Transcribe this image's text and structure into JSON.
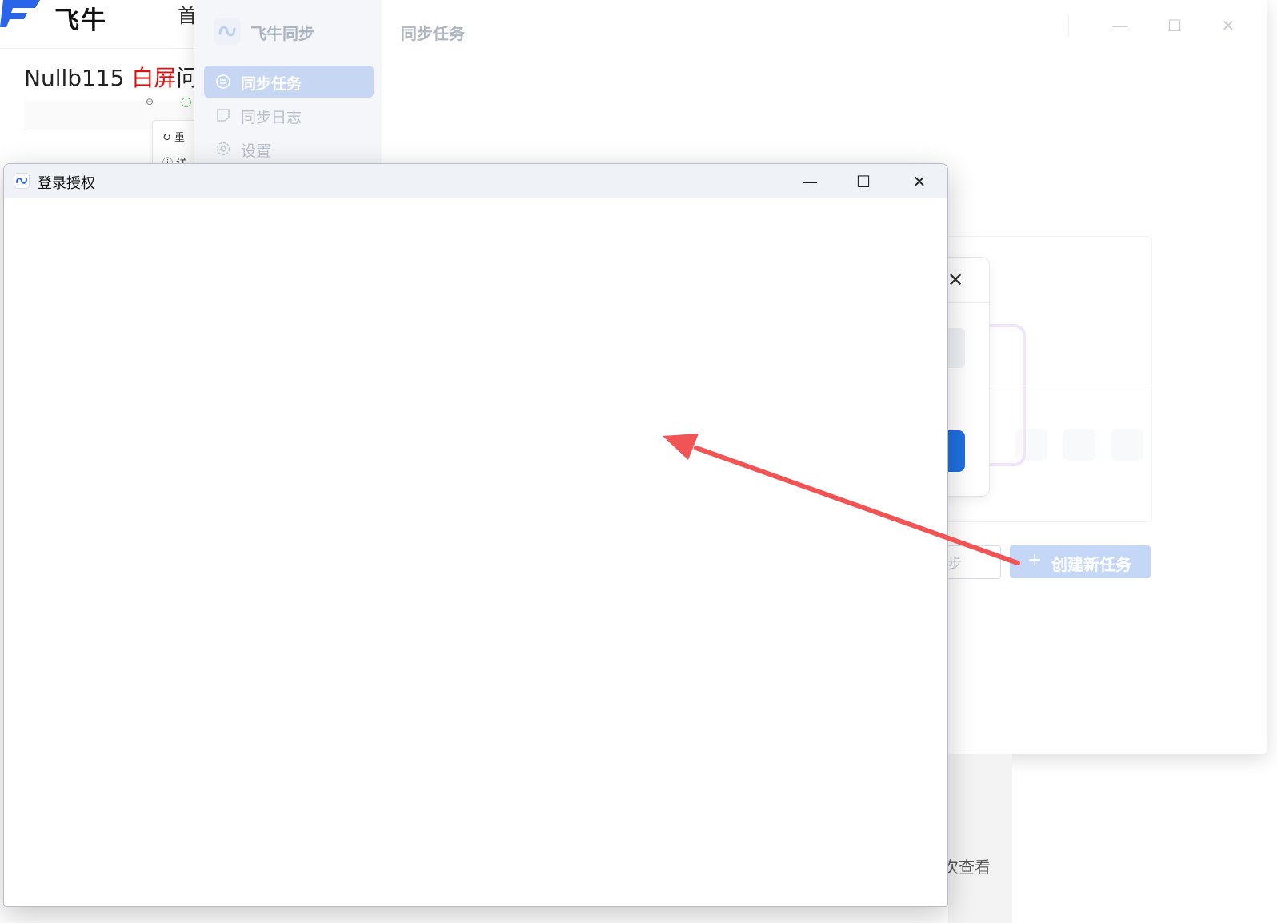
{
  "background_site": {
    "logo_text": "飞牛",
    "nav_item": "首",
    "post_title_prefix": "Nullb115 ",
    "post_title_highlight": "白屏",
    "post_title_suffix": "问",
    "menu_items": [
      "重",
      "详"
    ]
  },
  "sync_app": {
    "app_name": "飞牛同步",
    "header_title": "同步任务",
    "sidebar": [
      {
        "label": "同步任务",
        "active": true
      },
      {
        "label": "同步日志",
        "active": false
      },
      {
        "label": "设置",
        "active": false
      }
    ],
    "buttons": {
      "secondary_partial": "步",
      "create_label": "创建新任务",
      "create_icon": "+"
    },
    "bottom_text_partial": "次查看"
  },
  "login_window": {
    "title": "登录授权",
    "controls": {
      "minimize": "—",
      "maximize": "☐",
      "close": "✕"
    }
  },
  "colors": {
    "accent_blue": "#1f6fe0",
    "sidebar_active": "#c6d6f3",
    "annotation_red": "#f05454",
    "highlight_red": "#e01010"
  }
}
